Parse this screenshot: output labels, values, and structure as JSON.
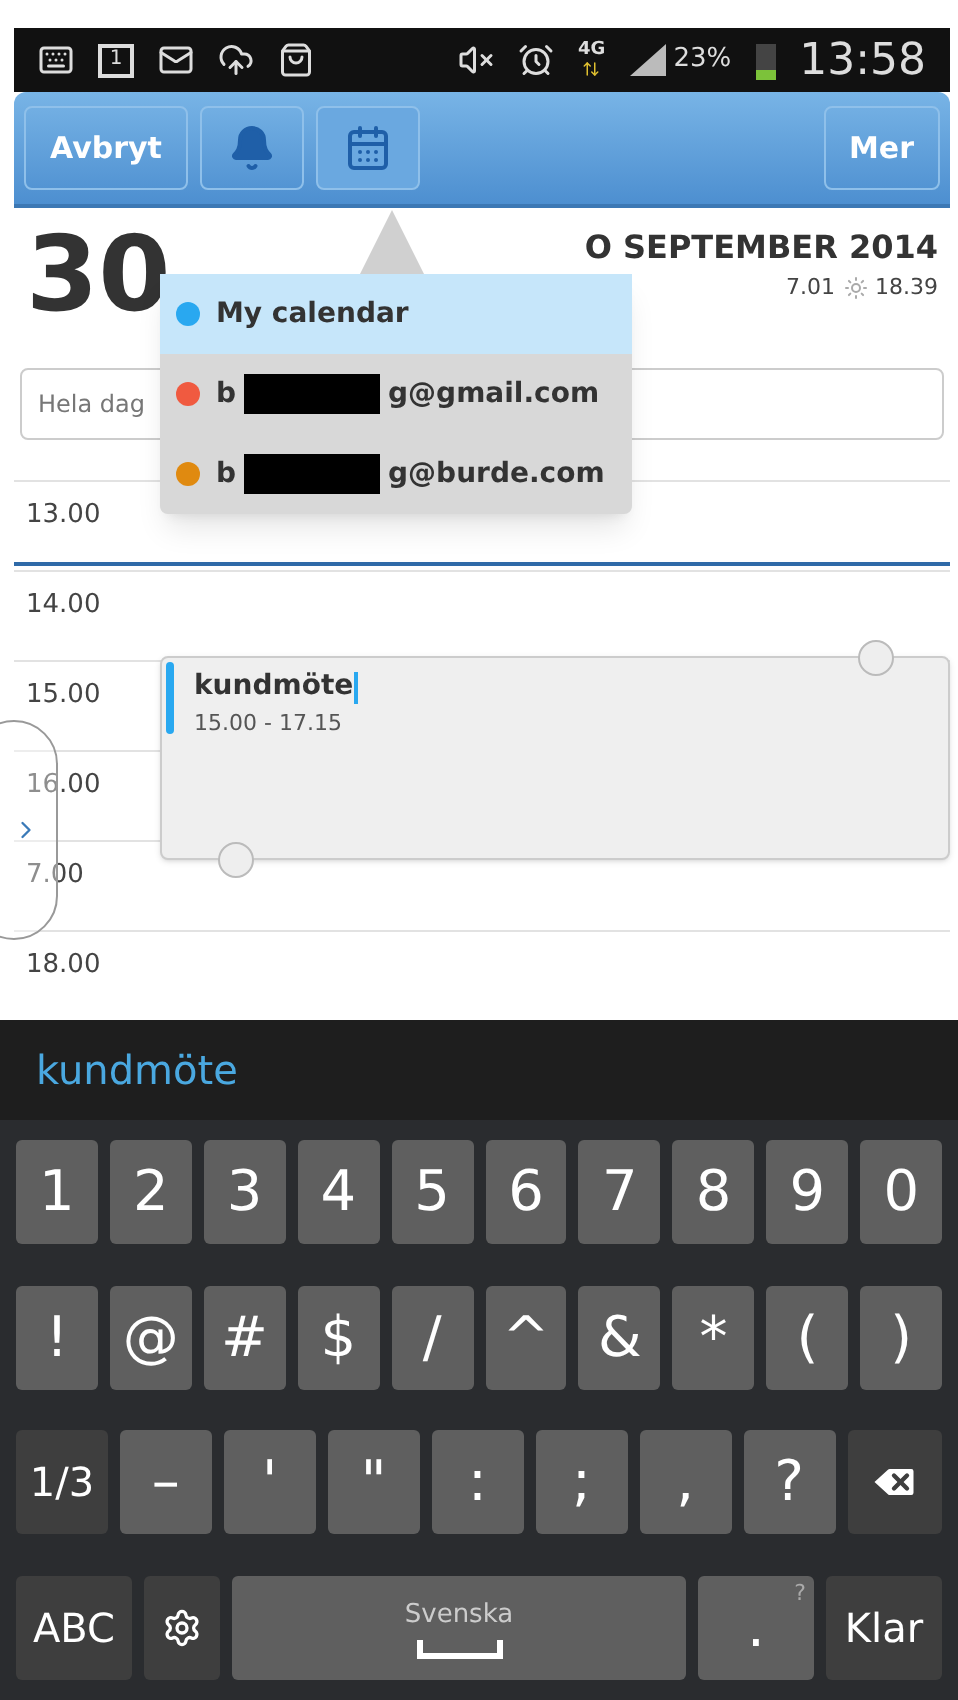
{
  "status_bar": {
    "calendar_day": "1",
    "network": "4G",
    "battery": "23%",
    "time": "13:58"
  },
  "toolbar": {
    "cancel": "Avbryt",
    "more": "Mer",
    "buttons": [
      {
        "kind": "bell",
        "selected": false
      },
      {
        "kind": "calendar",
        "selected": true
      }
    ]
  },
  "header": {
    "day_number": "30",
    "month_label": "O SEPTEMBER 2014",
    "sunrise": "7.01",
    "sunset": "18.39"
  },
  "all_day_field": {
    "placeholder": "Hela dag"
  },
  "calendar_menu": [
    {
      "prefix": "My calendar",
      "redacted": false,
      "color": "#29a8f0",
      "selected": true
    },
    {
      "prefix": "b",
      "suffix": "g@gmail.com",
      "redacted": true,
      "color": "#f05a40",
      "selected": false
    },
    {
      "prefix": "b",
      "suffix": "g@burde.com",
      "redacted": true,
      "color": "#e08a10",
      "selected": false
    }
  ],
  "hours": [
    "13.00",
    "14.00",
    "15.00",
    "16.00",
    "7.00",
    "18.00"
  ],
  "event": {
    "title": "kundmöte",
    "time": "15.00 - 17.15"
  },
  "input_text": "kundmöte",
  "keyboard": [
    [
      {
        "kind": "char",
        "label": "1"
      },
      {
        "kind": "char",
        "label": "2"
      },
      {
        "kind": "char",
        "label": "3"
      },
      {
        "kind": "char",
        "label": "4"
      },
      {
        "kind": "char",
        "label": "5"
      },
      {
        "kind": "char",
        "label": "6"
      },
      {
        "kind": "char",
        "label": "7"
      },
      {
        "kind": "char",
        "label": "8"
      },
      {
        "kind": "char",
        "label": "9"
      },
      {
        "kind": "char",
        "label": "0"
      }
    ],
    [
      {
        "kind": "char",
        "label": "!"
      },
      {
        "kind": "char",
        "label": "@"
      },
      {
        "kind": "char",
        "label": "#"
      },
      {
        "kind": "char",
        "label": "$"
      },
      {
        "kind": "char",
        "label": "/"
      },
      {
        "kind": "char",
        "label": "^"
      },
      {
        "kind": "char",
        "label": "&"
      },
      {
        "kind": "char",
        "label": "*"
      },
      {
        "kind": "char",
        "label": "("
      },
      {
        "kind": "char",
        "label": ")"
      }
    ],
    [
      {
        "kind": "mode",
        "label": "1/3"
      },
      {
        "kind": "char",
        "label": "–"
      },
      {
        "kind": "char",
        "label": "'"
      },
      {
        "kind": "char",
        "label": "\""
      },
      {
        "kind": "char",
        "label": ":"
      },
      {
        "kind": "char",
        "label": ";"
      },
      {
        "kind": "char",
        "label": ","
      },
      {
        "kind": "char",
        "label": "?"
      },
      {
        "kind": "backspace"
      }
    ],
    [
      {
        "kind": "mode",
        "label": "ABC"
      },
      {
        "kind": "settings"
      },
      {
        "kind": "space",
        "label": "Svenska"
      },
      {
        "kind": "char",
        "label": ".",
        "hint": "?"
      },
      {
        "kind": "mode",
        "label": "Klar"
      }
    ]
  ]
}
